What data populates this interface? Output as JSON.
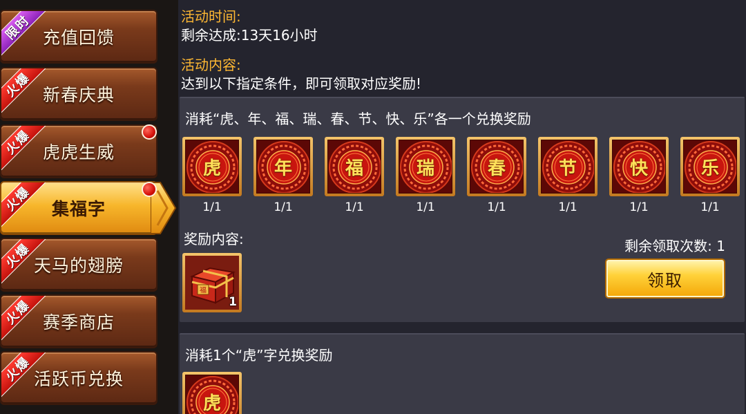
{
  "sidebar": {
    "items": [
      {
        "label": "充值回馈",
        "badge": "限时",
        "badge_type": "limited",
        "red_dot": false,
        "active": false
      },
      {
        "label": "新春庆典",
        "badge": "火爆",
        "badge_type": "hot",
        "red_dot": false,
        "active": false
      },
      {
        "label": "虎虎生威",
        "badge": "火爆",
        "badge_type": "hot",
        "red_dot": true,
        "active": false
      },
      {
        "label": "集福字",
        "badge": "火爆",
        "badge_type": "hot",
        "red_dot": true,
        "active": true
      },
      {
        "label": "天马的翅膀",
        "badge": "火爆",
        "badge_type": "hot",
        "red_dot": false,
        "active": false
      },
      {
        "label": "赛季商店",
        "badge": "火爆",
        "badge_type": "hot",
        "red_dot": false,
        "active": false
      },
      {
        "label": "活跃币兑换",
        "badge": "火爆",
        "badge_type": "hot",
        "red_dot": false,
        "active": false
      }
    ]
  },
  "activity": {
    "time_label": "活动时间:",
    "time_value": "剩余达成:13天16小时",
    "content_label": "活动内容:",
    "content_value": "达到以下指定条件，即可领取对应奖励!"
  },
  "exchange1": {
    "title": "消耗“虎、年、福、瑞、春、节、快、乐”各一个兑换奖励",
    "items": [
      {
        "char": "虎",
        "count": "1/1"
      },
      {
        "char": "年",
        "count": "1/1"
      },
      {
        "char": "福",
        "count": "1/1"
      },
      {
        "char": "瑞",
        "count": "1/1"
      },
      {
        "char": "春",
        "count": "1/1"
      },
      {
        "char": "节",
        "count": "1/1"
      },
      {
        "char": "快",
        "count": "1/1"
      },
      {
        "char": "乐",
        "count": "1/1"
      }
    ],
    "reward_label": "奖励内容:",
    "reward_item": {
      "icon": "treasure-chest-icon",
      "qty": "1"
    },
    "remain_text": "剩余领取次数: 1",
    "claim_label": "领取"
  },
  "exchange2": {
    "title": "消耗1个“虎”字兑换奖励",
    "items": [
      {
        "char": "虎"
      }
    ]
  },
  "colors": {
    "accent_orange": "#ffb833",
    "hot_badge": "#e01a12",
    "limited_badge": "#b03ad8",
    "claim_button": "#ffd23a"
  }
}
